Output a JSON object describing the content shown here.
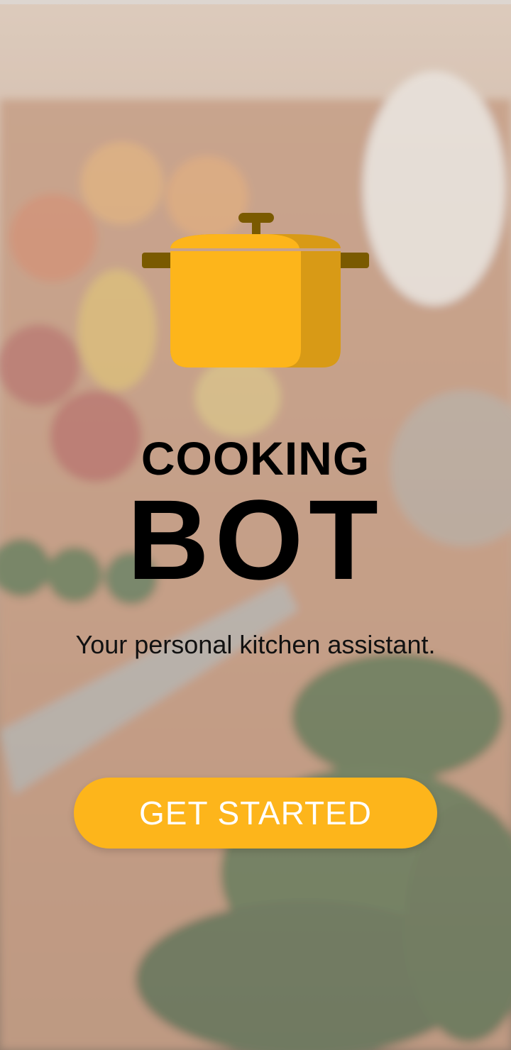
{
  "app": {
    "title_line1": "COOKING",
    "title_line2": "BOT",
    "tagline": "Your personal kitchen assistant."
  },
  "cta": {
    "label": "GET STARTED"
  },
  "logo": {
    "icon": "cooking-pot-icon"
  },
  "colors": {
    "accent": "#fdb51b",
    "accent_dark": "#d89a16",
    "handle": "#7a5a00",
    "text": "#000000",
    "button_text": "#ffffff"
  }
}
